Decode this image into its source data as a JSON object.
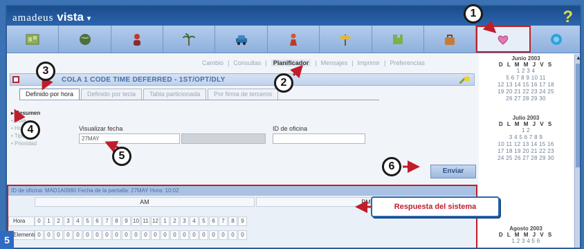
{
  "app": {
    "brand_light": "amadeus",
    "brand_bold": "vista",
    "menu_arrow": "▾",
    "help": "?"
  },
  "icons": [
    "world-map-icon",
    "globe-icon",
    "person-icon",
    "palm-tree-icon",
    "car-icon",
    "traveler-icon",
    "signpost-icon",
    "puzzle-icon",
    "bag-icon",
    "calendar-heart-icon",
    "globe-help-icon"
  ],
  "nav": {
    "links": [
      "Cambio",
      "Consultas",
      "Planificador",
      "Mensajes",
      "Imprimir",
      "Preferencias"
    ],
    "selected_index": 2
  },
  "title": {
    "text": "COLA 1 CODE TIME DEFERRED - 1ST/OPT/DLY"
  },
  "tabs": [
    "Definido por hora",
    "Definido por tecla",
    "Tabla particionada",
    "Por firma de terceros"
  ],
  "sidebar": {
    "head": "Resumen",
    "items": [
      "Cola",
      "Hora",
      "Tipo",
      "Prioridad"
    ]
  },
  "form": {
    "date_label": "Visualizar fecha",
    "date_value": "27MAY",
    "grey_label": "",
    "office_label": "ID de oficina",
    "office_value": "",
    "send_label": "Enviar"
  },
  "calendar": [
    {
      "title": "Junio 2003",
      "weekdays": "D L M M J V S",
      "lines": [
        "1 2 3 4",
        "5 6 7 8 9 10 11",
        "12 13 14 15 16 17 18",
        "19 20 21 22 23 24 25",
        "26 27 28 29 30"
      ]
    },
    {
      "title": "Julio 2003",
      "weekdays": "D L M M J V S",
      "lines": [
        "1 2",
        "3 4 5 6 7 8 9",
        "10 11 12 13 14 15 16",
        "17 18 19 20 21 22 23",
        "24 25 26 27 28 29 30"
      ]
    },
    {
      "title": "Agosto 2003",
      "weekdays": "D L M M J V S",
      "lines": [
        "1 2 3 4 5 6"
      ]
    }
  ],
  "response": {
    "header": "ID de oficina: MAD1A0980   Fecha de la pantalla: 27MAY   Hora: 10:02",
    "am": "AM",
    "pm": "PM",
    "hour_row_label": "Hora",
    "count_row_label": "Elemento",
    "hours": [
      "0",
      "1",
      "2",
      "3",
      "4",
      "5",
      "6",
      "7",
      "8",
      "9",
      "10",
      "11",
      "12",
      "1",
      "2",
      "3",
      "4",
      "5",
      "6",
      "7",
      "8",
      "9"
    ],
    "counts": [
      "0",
      "0",
      "0",
      "0",
      "0",
      "0",
      "0",
      "0",
      "0",
      "0",
      "0",
      "0",
      "0",
      "0",
      "0",
      "0",
      "0",
      "0",
      "0",
      "0",
      "0",
      "0"
    ]
  },
  "callout": {
    "text": "Respuesta del sistema"
  },
  "markers": [
    "1",
    "2",
    "3",
    "4",
    "5",
    "6"
  ],
  "figure_number": "5",
  "colors": {
    "accent_red": "#c01d2b",
    "brand_blue": "#2c65ad",
    "help_yellow": "#e9d944"
  }
}
